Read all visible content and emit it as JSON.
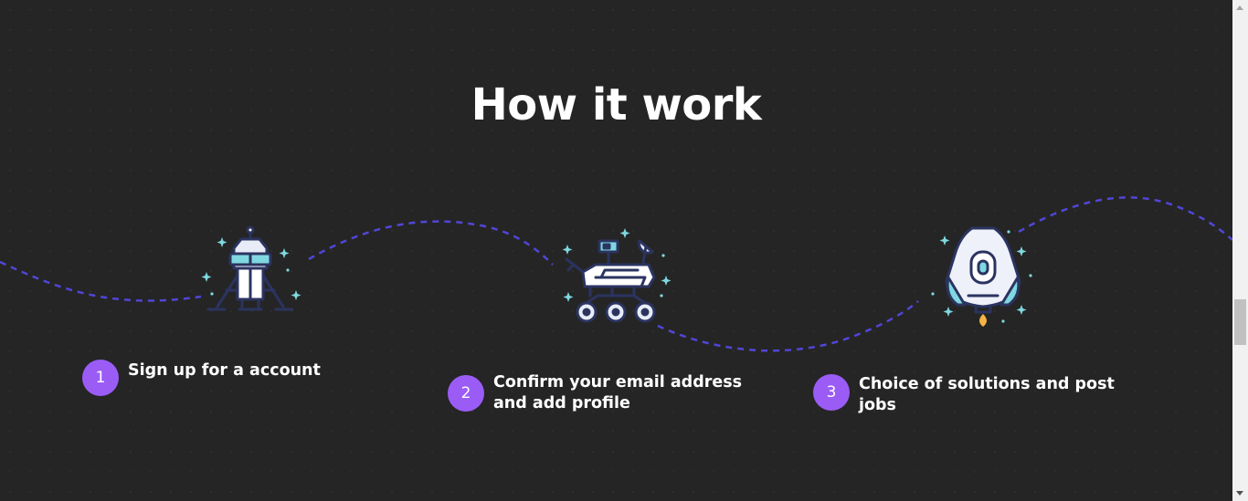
{
  "heading": "How it work",
  "steps": [
    {
      "number": "1",
      "text": "Sign up for a account",
      "icon": "lunar-lander-icon"
    },
    {
      "number": "2",
      "text": "Confirm your email address and add profile",
      "icon": "mars-rover-icon"
    },
    {
      "number": "3",
      "text": "Choice of solutions and post jobs",
      "icon": "space-capsule-icon"
    }
  ],
  "colors": {
    "background": "#252525",
    "accent": "#9b5cf6",
    "wave": "#5146d8",
    "icon_outline": "#2b3460",
    "icon_cyan": "#7fd8e0"
  }
}
